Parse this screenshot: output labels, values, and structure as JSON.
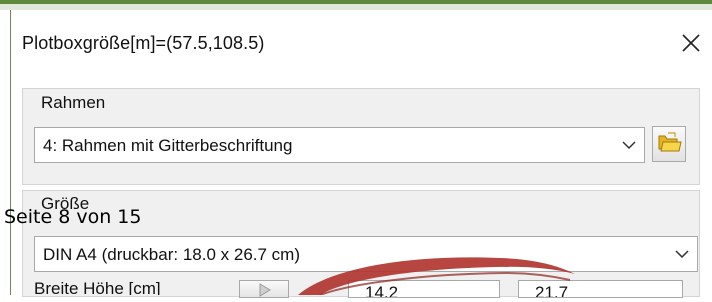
{
  "dialog": {
    "title": "Plotboxgröße[m]=(57.5,108.5)",
    "close_glyph": "×"
  },
  "rahmen": {
    "label": "Rahmen",
    "selected": "4: Rahmen mit Gitterbeschriftung"
  },
  "groesse": {
    "label": "Größe",
    "selected": "DIN A4 (druckbar: 18.0 x 26.7 cm)"
  },
  "overlay": {
    "page_counter": "Seite 8 von 15"
  },
  "bottom_row": {
    "label": "Breite Höhe [cm]",
    "input1_value": "14.2",
    "input2_value": "21.7"
  },
  "colors": {
    "accent_green": "#5f8a3d",
    "swoosh_red": "#b0362f"
  },
  "icons": {
    "close": "close-icon",
    "dropdown": "chevron-down-icon",
    "folder": "folder-icon",
    "play": "play-icon"
  }
}
